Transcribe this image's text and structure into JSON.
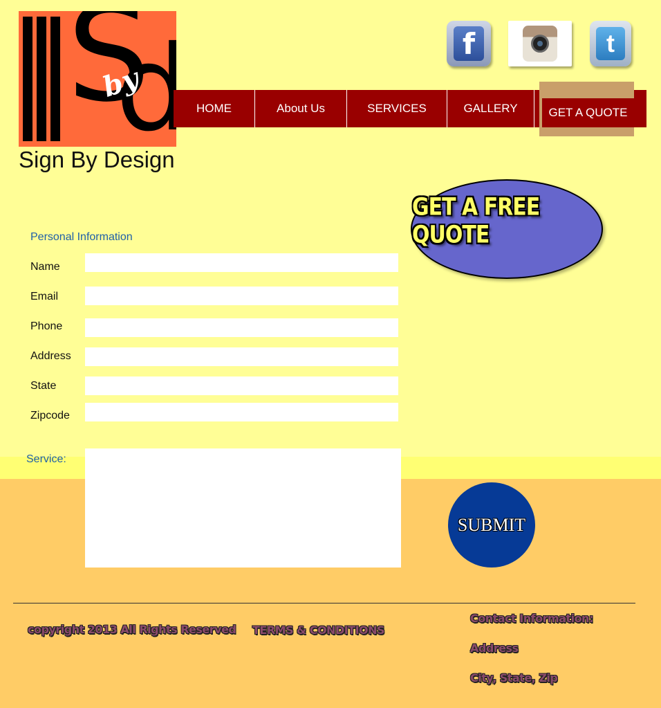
{
  "logo": {
    "initial_s": "S",
    "initial_d": "d",
    "by": "by",
    "name": "Sign By Design"
  },
  "social": [
    {
      "name": "facebook-icon",
      "glyph": "f"
    },
    {
      "name": "instagram-icon",
      "glyph": ""
    },
    {
      "name": "twitter-icon",
      "glyph": "t"
    }
  ],
  "nav": {
    "items": [
      "HOME",
      "About Us",
      "SERVICES",
      "GALLERY"
    ],
    "active": "GET A QUOTE"
  },
  "promo": {
    "label": "GET A FREE QUOTE"
  },
  "form": {
    "section_title": "Personal Information",
    "fields": [
      {
        "label": "Name",
        "value": ""
      },
      {
        "label": "Email",
        "value": ""
      },
      {
        "label": "Phone",
        "value": ""
      },
      {
        "label": "Address",
        "value": ""
      },
      {
        "label": "State",
        "value": ""
      },
      {
        "label": "Zipcode",
        "value": ""
      }
    ],
    "service_label": "Service:",
    "service_value": ""
  },
  "submit": {
    "label": "SUBMIT"
  },
  "footer": {
    "copyright": "copyright 2013 All Rights Reserved",
    "terms": "TERMS & CONDITIONS",
    "contact_title": "Contact Information:",
    "address": "Address",
    "city_state_zip": "City, State, Zip"
  },
  "colors": {
    "background": "#FFFE96",
    "footer_bg": "#FFCC66",
    "nav_bg": "#990000",
    "nav_active_frame": "#C99F6A",
    "promo_bg": "#6666CC",
    "promo_text": "#FFFF66",
    "submit_bg": "#063A96",
    "section_title": "#1E5FA8"
  }
}
